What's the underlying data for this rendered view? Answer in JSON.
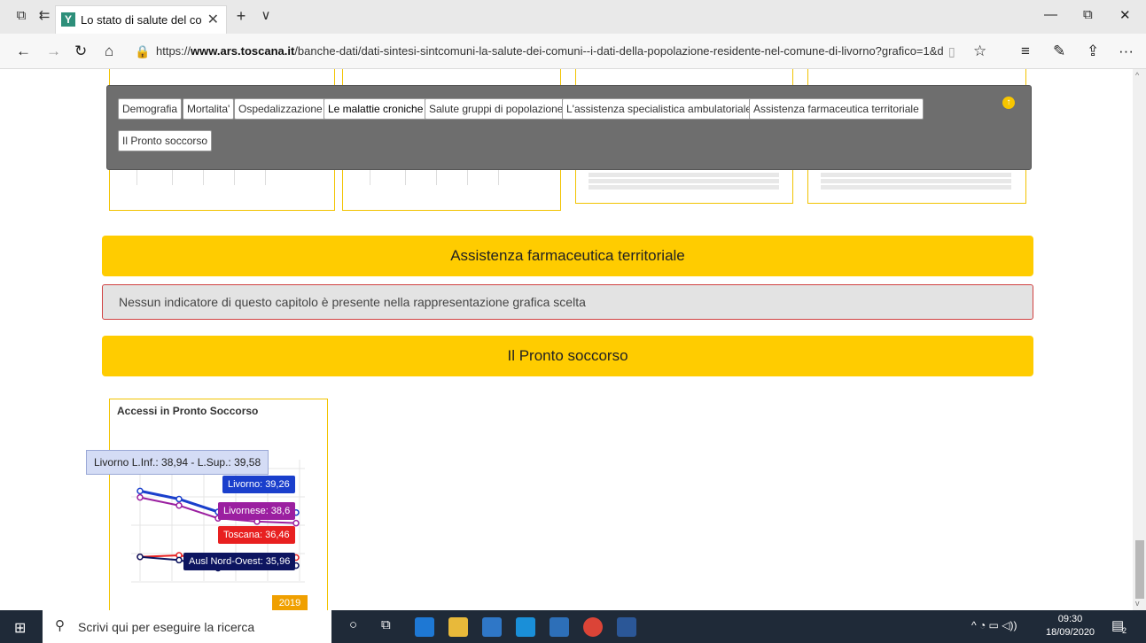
{
  "browser": {
    "tab_title": "Lo stato di salute del co",
    "tab_close": "✕",
    "new_tab": "+",
    "tab_list": "∨",
    "url_prefix": "https://",
    "url_domain": "www.ars.toscana.it",
    "url_path": "/banche-dati/dati-sintesi-sintcomuni-la-salute-dei-comuni--i-dati-della-popolazione-residente-nel-comune-di-livorno?grafico=1&d"
  },
  "menu": {
    "items": [
      {
        "label": "Demografia"
      },
      {
        "label": "Mortalita'"
      },
      {
        "label": "Ospedalizzazione"
      },
      {
        "label": "Le malattie croniche"
      },
      {
        "label": "Salute gruppi di popolazione"
      },
      {
        "label": "L'assistenza specialistica ambulatoriale"
      },
      {
        "label": "Assistenza farmaceutica territoriale"
      },
      {
        "label": "Il Pronto soccorso"
      }
    ]
  },
  "sections": {
    "farmaceutica_title": "Assistenza farmaceutica territoriale",
    "notice": "Nessun indicatore di questo capitolo è presente nella rappresentazione grafica scelta",
    "pronto_title": "Il Pronto soccorso"
  },
  "chart_data": {
    "type": "line",
    "title": "Accessi in Pronto Soccorso",
    "year_label": "2019",
    "tooltip": "Livorno L.Inf.: 38,94 - L.Sup.: 39,58",
    "series": [
      {
        "name": "Livorno",
        "label": "Livorno: 39,26",
        "color": "#1a3fcc",
        "values": [
          40.6,
          40.1,
          39.3,
          39.0,
          39.26
        ]
      },
      {
        "name": "Livornese",
        "label": "Livornese: 38,6",
        "color": "#9b1fa0",
        "values": [
          40.2,
          39.7,
          38.9,
          38.7,
          38.6
        ]
      },
      {
        "name": "Toscana",
        "label": "Toscana: 36,46",
        "color": "#e82020",
        "values": [
          36.5,
          36.6,
          36.2,
          36.4,
          36.46
        ]
      },
      {
        "name": "Ausl Nord-Ovest",
        "label": "Ausl Nord-Ovest: 35,96",
        "color": "#0d1560",
        "values": [
          36.5,
          36.3,
          35.8,
          35.9,
          35.96
        ]
      }
    ],
    "ylim": [
      35,
      42
    ]
  },
  "taskbar": {
    "search_placeholder": "Scrivi qui per eseguire la ricerca",
    "time": "09:30",
    "date": "18/09/2020",
    "notif_count": "2"
  }
}
